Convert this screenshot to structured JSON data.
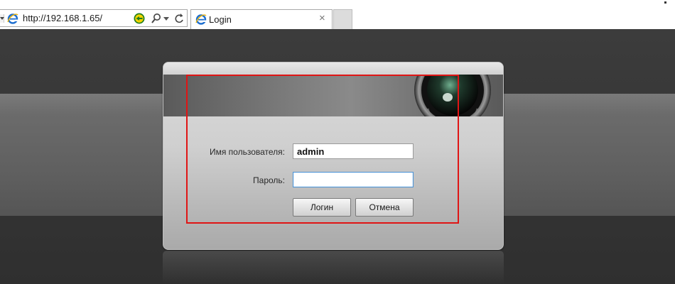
{
  "browser": {
    "url": "http://192.168.1.65/",
    "tab_title": "Login",
    "tab_close": "×"
  },
  "login": {
    "username_label": "Имя пользователя:",
    "username_value": "admin",
    "password_label": "Пароль:",
    "password_value": "",
    "login_button": "Логин",
    "cancel_button": "Отмена"
  },
  "colors": {
    "highlight": "#e01515",
    "focus_border": "#4f95d6"
  },
  "icons": [
    "ie-logo-icon",
    "compatibility-icon",
    "search-icon",
    "dropdown-arrow-icon",
    "refresh-icon",
    "close-icon",
    "camera-lens-icon"
  ]
}
